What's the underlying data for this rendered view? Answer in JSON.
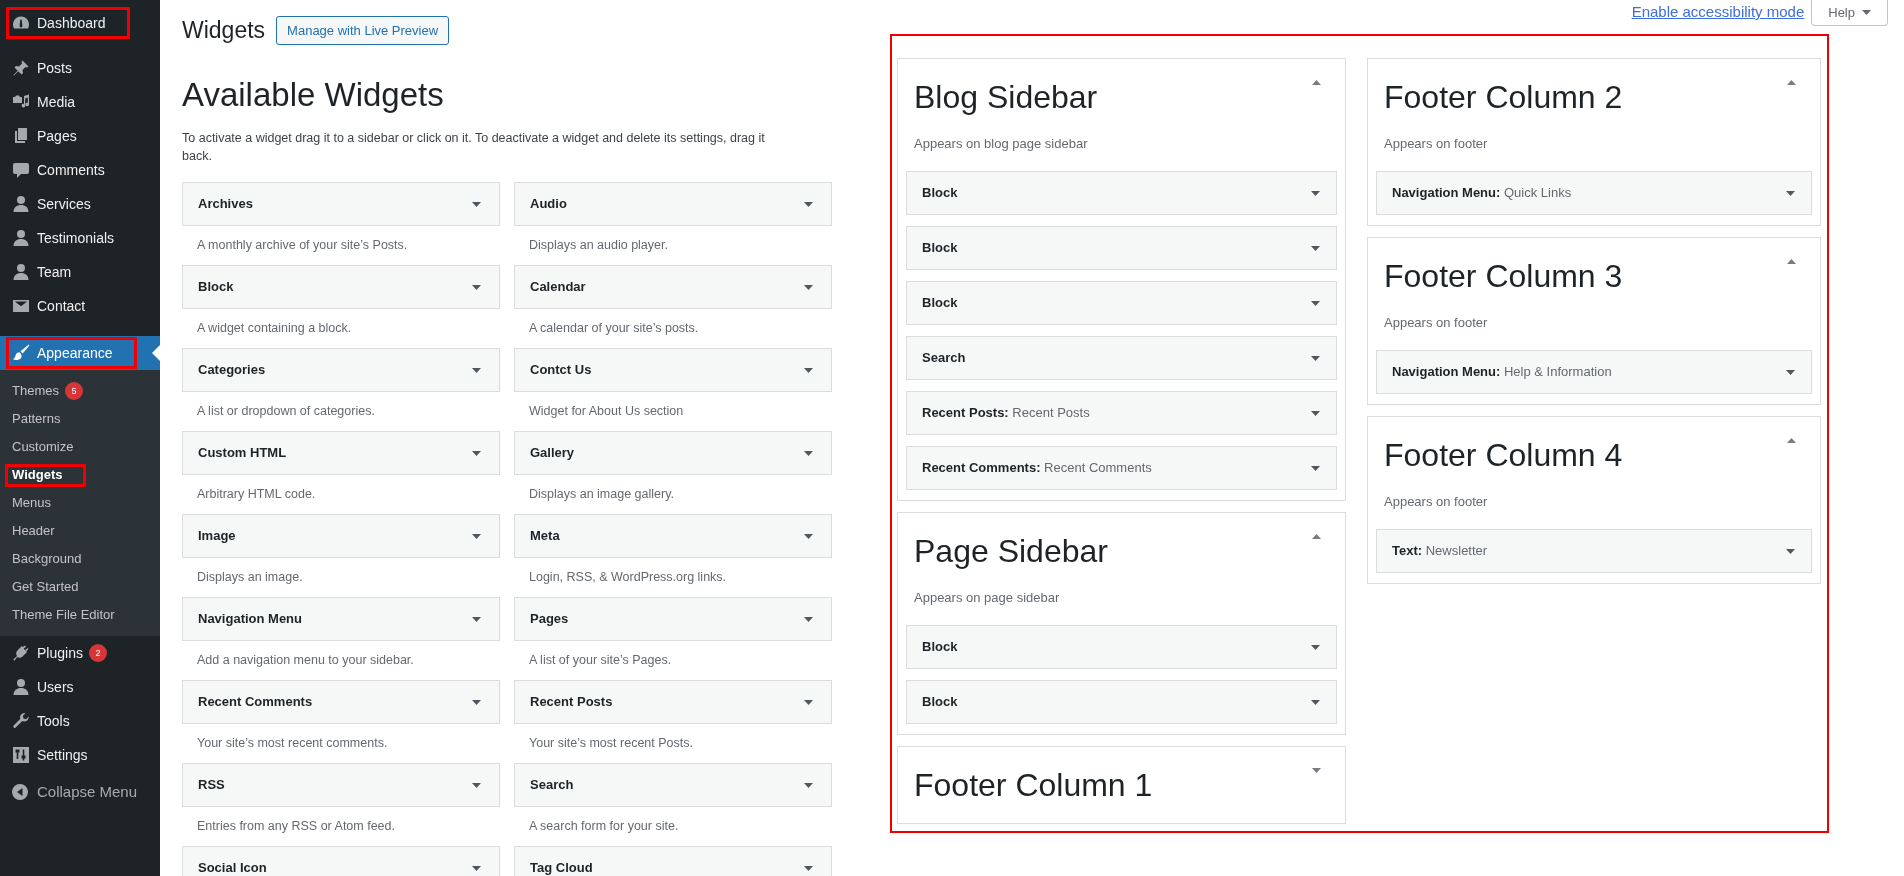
{
  "admin_menu": [
    {
      "label": "Dashboard",
      "selected": false,
      "highlighted": true
    },
    {
      "label": "Posts",
      "selected": false,
      "highlighted": false
    },
    {
      "label": "Media",
      "selected": false,
      "highlighted": false
    },
    {
      "label": "Pages",
      "selected": false,
      "highlighted": false
    },
    {
      "label": "Comments",
      "selected": false,
      "highlighted": false
    },
    {
      "label": "Services",
      "selected": false,
      "highlighted": false
    },
    {
      "label": "Testimonials",
      "selected": false,
      "highlighted": false
    },
    {
      "label": "Team",
      "selected": false,
      "highlighted": false
    },
    {
      "label": "Contact",
      "selected": false,
      "highlighted": false
    },
    {
      "label": "Appearance",
      "selected": true,
      "highlighted": true,
      "children": [
        {
          "label": "Themes",
          "badge": "5",
          "selected": false,
          "highlighted": false
        },
        {
          "label": "Patterns",
          "selected": false,
          "highlighted": false
        },
        {
          "label": "Customize",
          "selected": false,
          "highlighted": false
        },
        {
          "label": "Widgets",
          "selected": true,
          "highlighted": true
        },
        {
          "label": "Menus",
          "selected": false,
          "highlighted": false
        },
        {
          "label": "Header",
          "selected": false,
          "highlighted": false
        },
        {
          "label": "Background",
          "selected": false,
          "highlighted": false
        },
        {
          "label": "Get Started",
          "selected": false,
          "highlighted": false
        },
        {
          "label": "Theme File Editor",
          "selected": false,
          "highlighted": false
        }
      ]
    },
    {
      "label": "Plugins",
      "badge": "2",
      "selected": false,
      "highlighted": false
    },
    {
      "label": "Users",
      "selected": false,
      "highlighted": false
    },
    {
      "label": "Tools",
      "selected": false,
      "highlighted": false
    },
    {
      "label": "Settings",
      "selected": false,
      "highlighted": false
    }
  ],
  "collapse_menu": "Collapse Menu",
  "page_header": {
    "title": "Widgets",
    "button": "Manage with Live Preview"
  },
  "screen_links": {
    "accessibility_link": "Enable accessibility mode",
    "help": "Help"
  },
  "available_widgets": {
    "heading": "Available Widgets",
    "description": "To activate a widget drag it to a sidebar or click on it. To deactivate a widget and delete its settings, drag it back.",
    "widgets": [
      {
        "title": "Archives",
        "description": "A monthly archive of your site’s Posts."
      },
      {
        "title": "Audio",
        "description": "Displays an audio player."
      },
      {
        "title": "Block",
        "description": "A widget containing a block."
      },
      {
        "title": "Calendar",
        "description": "A calendar of your site’s posts."
      },
      {
        "title": "Categories",
        "description": "A list or dropdown of categories."
      },
      {
        "title": "Contct Us",
        "description": "Widget for About Us section"
      },
      {
        "title": "Custom HTML",
        "description": "Arbitrary HTML code."
      },
      {
        "title": "Gallery",
        "description": "Displays an image gallery."
      },
      {
        "title": "Image",
        "description": "Displays an image."
      },
      {
        "title": "Meta",
        "description": "Login, RSS, & WordPress.org links."
      },
      {
        "title": "Navigation Menu",
        "description": "Add a navigation menu to your sidebar."
      },
      {
        "title": "Pages",
        "description": "A list of your site’s Pages."
      },
      {
        "title": "Recent Comments",
        "description": "Your site’s most recent comments."
      },
      {
        "title": "Recent Posts",
        "description": "Your site’s most recent Posts."
      },
      {
        "title": "RSS",
        "description": "Entries from any RSS or Atom feed."
      },
      {
        "title": "Search",
        "description": "A search form for your site."
      },
      {
        "title": "Social Icon"
      },
      {
        "title": "Tag Cloud"
      }
    ]
  },
  "widget_areas": {
    "highlighted": true,
    "columns": [
      {
        "areas": [
          {
            "title": "Blog Sidebar",
            "expanded": true,
            "description": "Appears on blog page sidebar",
            "widgets": [
              {
                "title": "Block"
              },
              {
                "title": "Block"
              },
              {
                "title": "Block"
              },
              {
                "title": "Search"
              },
              {
                "title": "Recent Posts:",
                "instance_title": "Recent Posts"
              },
              {
                "title": "Recent Comments:",
                "instance_title": "Recent Comments"
              }
            ]
          },
          {
            "title": "Page Sidebar",
            "expanded": true,
            "description": "Appears on page sidebar",
            "widgets": [
              {
                "title": "Block"
              },
              {
                "title": "Block"
              }
            ]
          },
          {
            "title": "Footer Column 1",
            "expanded": false
          }
        ]
      },
      {
        "areas": [
          {
            "title": "Footer Column 2",
            "expanded": true,
            "description": "Appears on footer",
            "widgets": [
              {
                "title": "Navigation Menu:",
                "instance_title": "Quick Links"
              }
            ]
          },
          {
            "title": "Footer Column 3",
            "expanded": true,
            "description": "Appears on footer",
            "widgets": [
              {
                "title": "Navigation Menu:",
                "instance_title": "Help & Information"
              }
            ]
          },
          {
            "title": "Footer Column 4",
            "expanded": true,
            "description": "Appears on footer",
            "widgets": [
              {
                "title": "Text:",
                "instance_title": "Newsletter"
              }
            ]
          }
        ]
      }
    ]
  }
}
